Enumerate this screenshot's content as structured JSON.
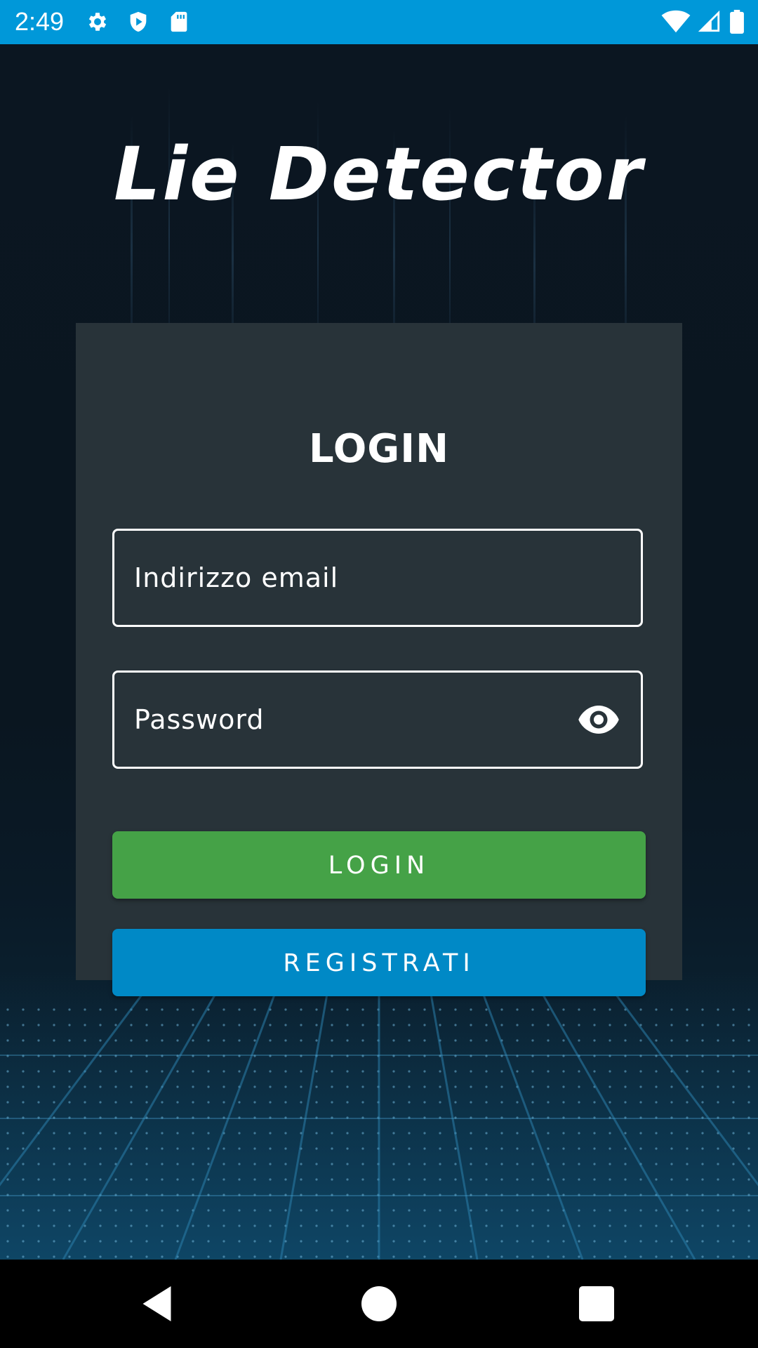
{
  "status_bar": {
    "time": "2:49",
    "left_icons": [
      "settings-icon",
      "play-protect-icon",
      "sd-card-icon"
    ],
    "right_icons": [
      "wifi-icon",
      "cell-signal-icon",
      "battery-icon"
    ]
  },
  "app": {
    "title": "Lie Detector"
  },
  "login_card": {
    "title": "LOGIN",
    "email_placeholder": "Indirizzo email",
    "password_placeholder": "Password",
    "password_toggle_icon": "eye-icon",
    "login_button": "LOGIN",
    "register_button": "REGISTRATI"
  },
  "nav_bar": {
    "buttons": [
      "back-icon",
      "home-icon",
      "recents-icon"
    ]
  },
  "colors": {
    "status_bar": "#0098d9",
    "background": "#0b1621",
    "card": "#283339",
    "login_button": "#45a247",
    "register_button": "#0089c6"
  }
}
